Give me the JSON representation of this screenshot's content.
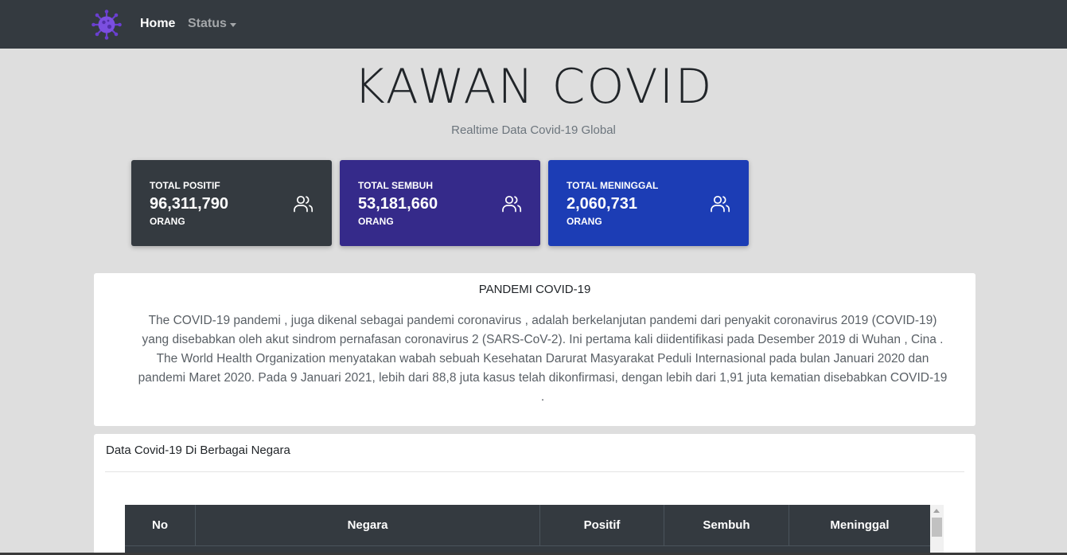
{
  "navbar": {
    "logo_icon": "virus-icon",
    "home_label": "Home",
    "status_label": "Status"
  },
  "hero": {
    "title": "KAWAN COVID",
    "subtitle": "Realtime Data Covid-19 Global"
  },
  "cards": [
    {
      "label": "TOTAL POSITIF",
      "value": "96,311,790",
      "unit": "ORANG",
      "icon": "users-icon",
      "color": "#343a40"
    },
    {
      "label": "TOTAL SEMBUH",
      "value": "53,181,660",
      "unit": "ORANG",
      "icon": "users-icon",
      "color": "#352a8a"
    },
    {
      "label": "TOTAL MENINGGAL",
      "value": "2,060,731",
      "unit": "ORANG",
      "icon": "users-icon",
      "color": "#1c3db5"
    }
  ],
  "info": {
    "title": "PANDEMI COVID-19",
    "text": "The COVID-19 pandemi , juga dikenal sebagai pandemi coronavirus , adalah berkelanjutan pandemi dari penyakit coronavirus 2019 (COVID-19) yang disebabkan oleh akut sindrom pernafasan coronavirus 2 (SARS-CoV-2). Ini pertama kali diidentifikasi pada Desember 2019 di Wuhan , Cina . The World Health Organization menyatakan wabah sebuah Kesehatan Darurat Masyarakat Peduli Internasional pada bulan Januari 2020 dan pandemi Maret 2020. Pada 9 Januari 2021, lebih dari 88,8 juta kasus telah dikonfirmasi, dengan lebih dari 1,91 juta kematian disebabkan COVID-19 ."
  },
  "data_table": {
    "title": "Data Covid-19 Di Berbagai Negara",
    "columns": [
      "No",
      "Negara",
      "Positif",
      "Sembuh",
      "Meninggal"
    ]
  }
}
